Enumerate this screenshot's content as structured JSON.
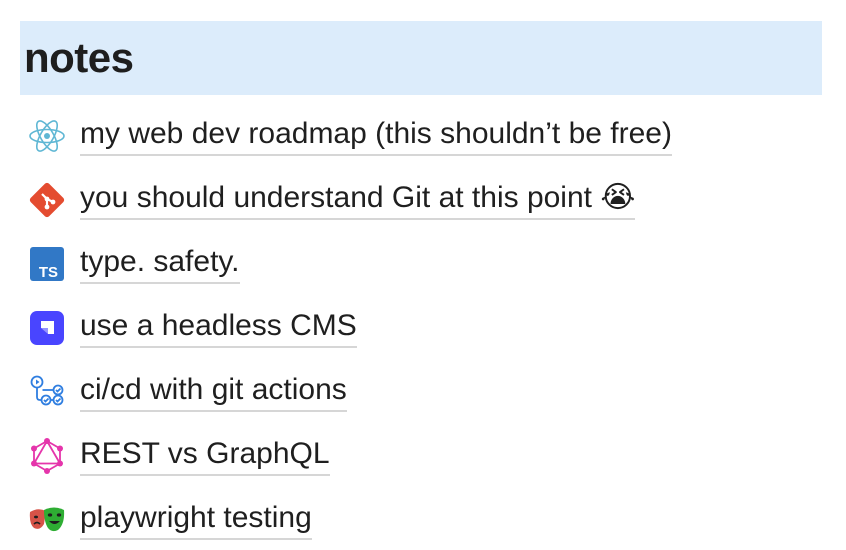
{
  "page": {
    "title": "notes"
  },
  "notes": [
    {
      "label": "my web dev roadmap (this shouldn’t be free)",
      "icon": "react-icon"
    },
    {
      "label": "you should understand Git at this point",
      "emoji": "😭",
      "icon": "git-icon"
    },
    {
      "label": "type. safety.",
      "icon": "typescript-icon"
    },
    {
      "label": "use a headless CMS",
      "icon": "strapi-icon"
    },
    {
      "label": "ci/cd with git actions",
      "icon": "github-actions-icon"
    },
    {
      "label": "REST vs GraphQL",
      "icon": "graphql-icon"
    },
    {
      "label": "playwright testing",
      "icon": "playwright-icon"
    }
  ],
  "colors": {
    "header_bg": "#dcecfb",
    "react": "#5fb7d4",
    "git": "#e44c30",
    "typescript": "#3178c6",
    "strapi": "#4945ff",
    "graphql": "#e535ab",
    "playwright_green": "#2ead33",
    "playwright_red": "#d65348"
  }
}
